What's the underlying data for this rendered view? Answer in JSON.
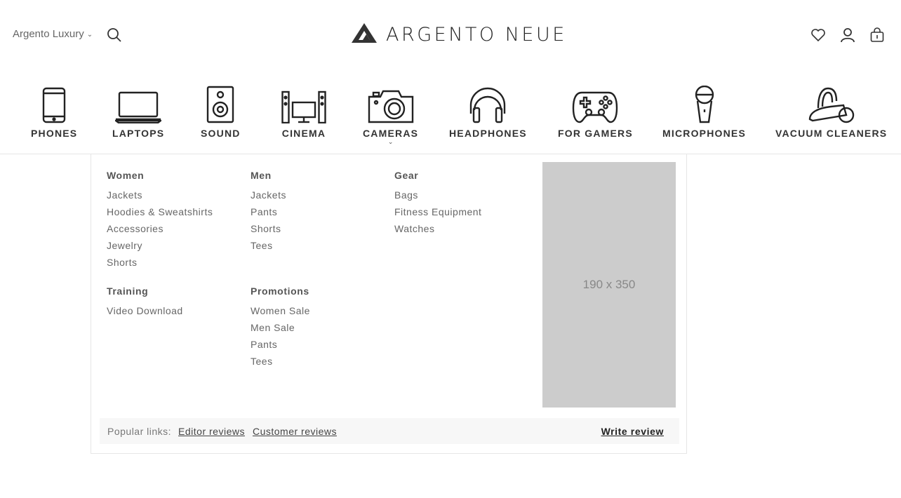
{
  "header": {
    "store_label": "Argento Luxury",
    "brand": "ARGENTO NEUE",
    "icons": [
      "wishlist-heart-icon",
      "account-user-icon",
      "cart-bag-icon"
    ]
  },
  "categories": [
    {
      "label": "PHONES",
      "icon": "phone-icon"
    },
    {
      "label": "LAPTOPS",
      "icon": "laptop-icon"
    },
    {
      "label": "SOUND",
      "icon": "speaker-icon"
    },
    {
      "label": "CINEMA",
      "icon": "home-cinema-icon"
    },
    {
      "label": "CAMERAS",
      "icon": "camera-icon",
      "active": true
    },
    {
      "label": "HEADPHONES",
      "icon": "headphones-icon"
    },
    {
      "label": "FOR GAMERS",
      "icon": "gamepad-icon"
    },
    {
      "label": "MICROPHONES",
      "icon": "microphone-icon"
    },
    {
      "label": "VACUUM CLEANERS",
      "icon": "vacuum-cleaner-icon"
    }
  ],
  "menu": {
    "women": {
      "title": "Women",
      "links": [
        "Jackets",
        "Hoodies & Sweatshirts",
        "Accessories",
        "Jewelry",
        "Shorts"
      ]
    },
    "men": {
      "title": "Men",
      "links": [
        "Jackets",
        "Pants",
        "Shorts",
        "Tees"
      ]
    },
    "gear": {
      "title": "Gear",
      "links": [
        "Bags",
        "Fitness Equipment",
        "Watches"
      ]
    },
    "training": {
      "title": "Training",
      "links": [
        "Video Download"
      ]
    },
    "promotions": {
      "title": "Promotions",
      "links": [
        "Women Sale",
        "Men Sale",
        "Pants",
        "Tees"
      ]
    },
    "placeholder_text": "190 x 350"
  },
  "popular": {
    "label": "Popular links:",
    "links": [
      "Editor reviews",
      "Customer reviews"
    ],
    "write_review": "Write review"
  },
  "colors": {
    "text": "#333333",
    "placeholder": "#cccccc",
    "popular_bg": "#f7f7f7"
  }
}
